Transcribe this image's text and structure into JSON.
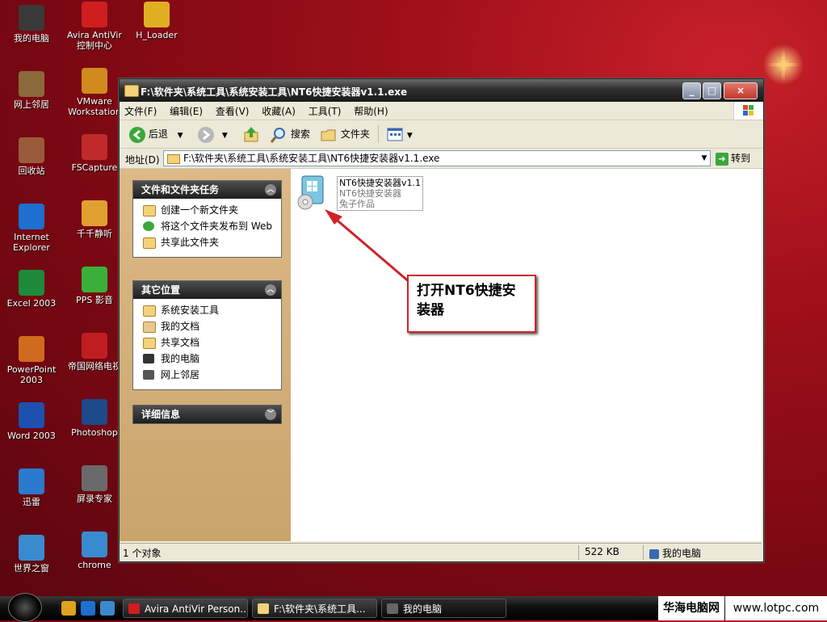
{
  "desktop": {
    "icons_col1": [
      {
        "label": "我的电脑",
        "icon": "my-computer-icon",
        "color": "#3a3a3a"
      },
      {
        "label": "网上邻居",
        "icon": "network-icon",
        "color": "#8a6a3a"
      },
      {
        "label": "回收站",
        "icon": "recycle-bin-icon",
        "color": "#9a5a3a"
      },
      {
        "label": "Internet Explorer",
        "icon": "ie-icon",
        "color": "#1e6fd0"
      },
      {
        "label": "Excel 2003",
        "icon": "excel-icon",
        "color": "#1e8a3a"
      },
      {
        "label": "PowerPoint 2003",
        "icon": "powerpoint-icon",
        "color": "#d06a1e"
      },
      {
        "label": "Word 2003",
        "icon": "word-icon",
        "color": "#1e50b0"
      },
      {
        "label": "迅雷",
        "icon": "xunlei-icon",
        "color": "#2a7ad0"
      },
      {
        "label": "世界之窗",
        "icon": "theworld-icon",
        "color": "#3a8ad0"
      }
    ],
    "icons_col2": [
      {
        "label": "Avira AntiVir 控制中心",
        "icon": "avira-icon",
        "color": "#d01e1e"
      },
      {
        "label": "VMware Workstation",
        "icon": "vmware-icon",
        "color": "#d08a1e"
      },
      {
        "label": "FSCapture",
        "icon": "fscapture-icon",
        "color": "#c02a2a"
      },
      {
        "label": "千千静听",
        "icon": "ttplayer-icon",
        "color": "#e0a030"
      },
      {
        "label": "PPS 影音",
        "icon": "pps-icon",
        "color": "#3ab03a"
      },
      {
        "label": "帝国网络电视",
        "icon": "tv-icon",
        "color": "#c01e1e"
      },
      {
        "label": "Photoshop",
        "icon": "photoshop-icon",
        "color": "#1e4a8a"
      },
      {
        "label": "屏录专家",
        "icon": "screen-recorder-icon",
        "color": "#6a6a6a"
      },
      {
        "label": "chrome",
        "icon": "chrome-icon",
        "color": "#3a8ad0"
      }
    ],
    "icons_col3": [
      {
        "label": "H_Loader",
        "icon": "hloader-icon",
        "color": "#e0b020"
      }
    ]
  },
  "window": {
    "title": "F:\\软件夹\\系统工具\\系统安装工具\\NT6快捷安装器v1.1.exe",
    "buttons": {
      "minimize": "_",
      "maximize": "□",
      "close": "×"
    },
    "menu": [
      "文件(F)",
      "编辑(E)",
      "查看(V)",
      "收藏(A)",
      "工具(T)",
      "帮助(H)"
    ],
    "toolbar": {
      "back": "后退",
      "search": "搜索",
      "folders": "文件夹"
    },
    "address": {
      "label": "地址(D)",
      "value": "F:\\软件夹\\系统工具\\系统安装工具\\NT6快捷安装器v1.1.exe",
      "go": "转到"
    },
    "panels": [
      {
        "title": "文件和文件夹任务",
        "items": [
          {
            "label": "创建一个新文件夹",
            "icon": "new-folder-icon"
          },
          {
            "label": "将这个文件夹发布到 Web",
            "icon": "publish-web-icon"
          },
          {
            "label": "共享此文件夹",
            "icon": "share-folder-icon"
          }
        ]
      },
      {
        "title": "其它位置",
        "items": [
          {
            "label": "系统安装工具",
            "icon": "folder-icon"
          },
          {
            "label": "我的文档",
            "icon": "my-documents-icon"
          },
          {
            "label": "共享文档",
            "icon": "shared-documents-icon"
          },
          {
            "label": "我的电脑",
            "icon": "my-computer-icon"
          },
          {
            "label": "网上邻居",
            "icon": "network-icon"
          }
        ]
      },
      {
        "title": "详细信息",
        "items": []
      }
    ],
    "file": {
      "name": "NT6快捷安装器v1.1",
      "desc": "NT6快捷安装器",
      "company": "兔子作品"
    },
    "status": {
      "count": "1 个对象",
      "size": "522 KB",
      "location": "我的电脑"
    }
  },
  "callout": {
    "text": "打开NT6快捷安装器"
  },
  "taskbar": {
    "tasks": [
      {
        "label": "Avira AntiVir Person...",
        "icon": "avira-icon"
      },
      {
        "label": "F:\\软件夹\\系统工具...",
        "icon": "folder-icon"
      },
      {
        "label": "我的电脑",
        "icon": "my-computer-icon"
      }
    ]
  },
  "watermark": {
    "left": "华海电脑网",
    "right": "www.lotpc.com"
  },
  "colors": {
    "accent": "#d0212a",
    "panel_bg": "#d9b47f"
  }
}
